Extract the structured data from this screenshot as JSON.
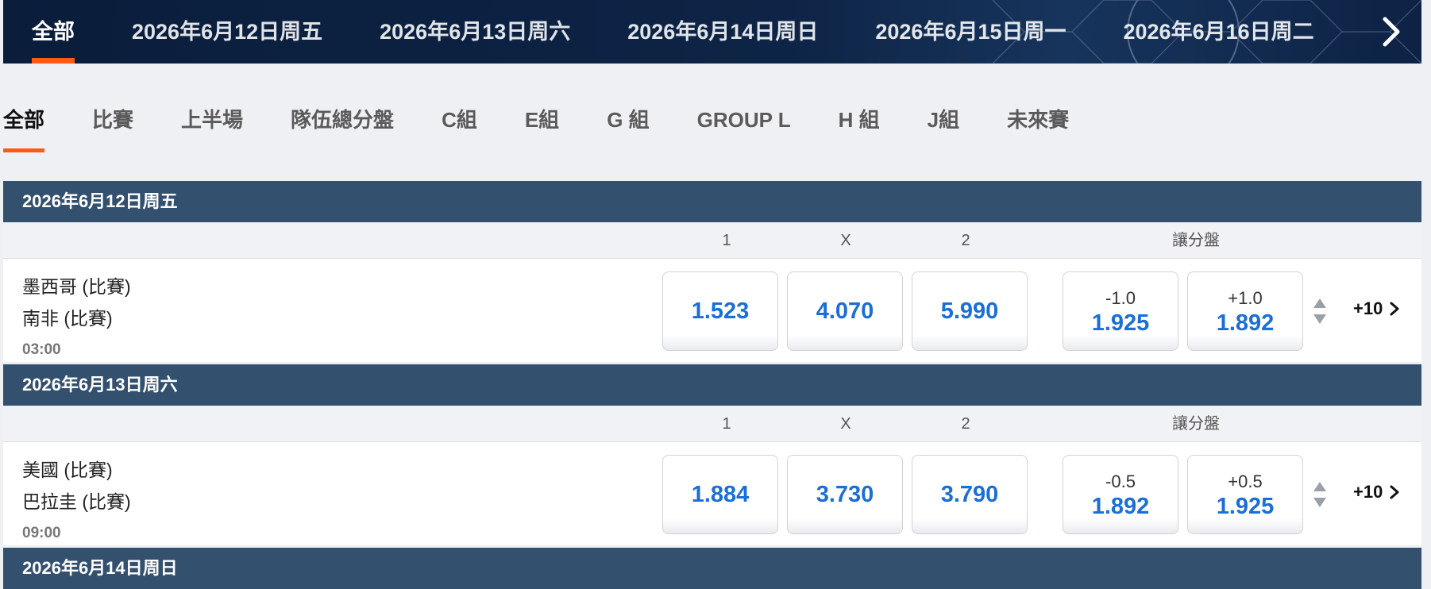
{
  "date_tabs": [
    "全部",
    "2026年6月12日周五",
    "2026年6月13日周六",
    "2026年6月14日周日",
    "2026年6月15日周一",
    "2026年6月16日周二"
  ],
  "category_tabs": [
    "全部",
    "比賽",
    "上半場",
    "隊伍總分盤",
    "C組",
    "E組",
    "G 組",
    "GROUP L",
    "H 組",
    "J組",
    "未來賽"
  ],
  "columns": {
    "home": "1",
    "draw": "X",
    "away": "2",
    "handicap": "讓分盤"
  },
  "sections": [
    {
      "date": "2026年6月12日周五",
      "match": {
        "home_team": "墨西哥 (比賽)",
        "away_team": "南非 (比賽)",
        "time": "03:00",
        "odds": {
          "home": "1.523",
          "draw": "4.070",
          "away": "5.990"
        },
        "handicap": [
          {
            "line": "-1.0",
            "odds": "1.925"
          },
          {
            "line": "+1.0",
            "odds": "1.892"
          }
        ],
        "more": "+10"
      }
    },
    {
      "date": "2026年6月13日周六",
      "match": {
        "home_team": "美國 (比賽)",
        "away_team": "巴拉圭 (比賽)",
        "time": "09:00",
        "odds": {
          "home": "1.884",
          "draw": "3.730",
          "away": "3.790"
        },
        "handicap": [
          {
            "line": "-0.5",
            "odds": "1.892"
          },
          {
            "line": "+0.5",
            "odds": "1.925"
          }
        ],
        "more": "+10"
      }
    },
    {
      "date": "2026年6月14日周日"
    }
  ],
  "colors": {
    "accent": "#ff5a14",
    "odds_blue": "#1a6fd6",
    "section_bg": "#33506e",
    "datebar_bg": "#0e2446"
  },
  "icons": {
    "next_dates": "chevron-right-icon",
    "odds_movement": "up-down-arrows-icon",
    "more_markets": "chevron-right-icon"
  }
}
